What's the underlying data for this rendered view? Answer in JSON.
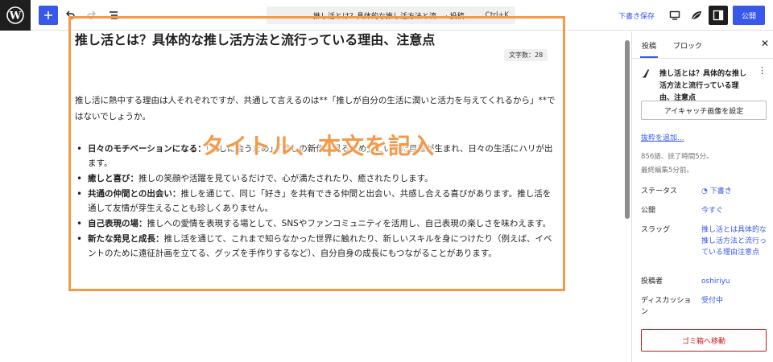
{
  "toolbar": {
    "command_title": "推し活とは？具体的な推し活方法と流...",
    "command_type": "· 投稿",
    "command_shortcut": "Ctrl+K",
    "save_draft": "下書き保存",
    "publish": "公開"
  },
  "editor": {
    "title": "推し活とは？具体的な推し活方法と流行っている理由、注意点",
    "char_count": "文字数：28",
    "paragraph": "推し活に熱中する理由は人それぞれですが、共通して言えるのは**「推しが自分の生活に潤いと活力を与えてくれるから」**ではないでしょうか。",
    "list": [
      {
        "bold": "日々のモチベーションになる：",
        "text": "「推しに会うため」「推しの新作を見るため」といった目標が生まれ、日々の生活にハリが出ます。"
      },
      {
        "bold": "癒しと喜び：",
        "text": "推しの笑顔や活躍を見ているだけで、心が満たされたり、癒されたりします。"
      },
      {
        "bold": "共通の仲間との出会い：",
        "text": "推しを通じて、同じ「好き」を共有できる仲間と出会い、共感し合える喜びがあります。推し活を通して友情が芽生えることも珍しくありません。"
      },
      {
        "bold": "自己表現の場：",
        "text": "推しへの愛情を表現する場として、SNSやファンコミュニティを活用し、自己表現の楽しさを味わえます。"
      },
      {
        "bold": "新たな発見と成長：",
        "text": "推し活を通じて、これまで知らなかった世界に触れたり、新しいスキルを身につけたり（例えば、イベントのために遠征計画を立てる、グッズを手作りするなど）、自分自身の成長にもつながることがあります。"
      }
    ],
    "overlay": "タイトル、本文を記入"
  },
  "sidebar": {
    "tab_post": "投稿",
    "tab_block": "ブロック",
    "post_title": "推し活とは？具体的な推し活方法と流行っている理由、注意点",
    "featured_image": "アイキャッチ画像を設定",
    "add_excerpt": "抜粋を追加...",
    "word_info": "856語、読了時間5分。",
    "last_edited": "最終編集5分前。",
    "status_label": "ステータス",
    "status_value": "下書き",
    "publish_label": "公開",
    "publish_value": "今すぐ",
    "slug_label": "スラッグ",
    "slug_value": "推し活とは具体的な推し活方法と流行っている理由注意点",
    "author_label": "投稿者",
    "author_value": "oshiriyu",
    "discussion_label": "ディスカッション",
    "discussion_value": "受付中",
    "trash": "ゴミ箱へ移動"
  },
  "colors": {
    "accent": "#3858e9",
    "highlight": "#f39a4a",
    "danger": "#cc1818"
  }
}
